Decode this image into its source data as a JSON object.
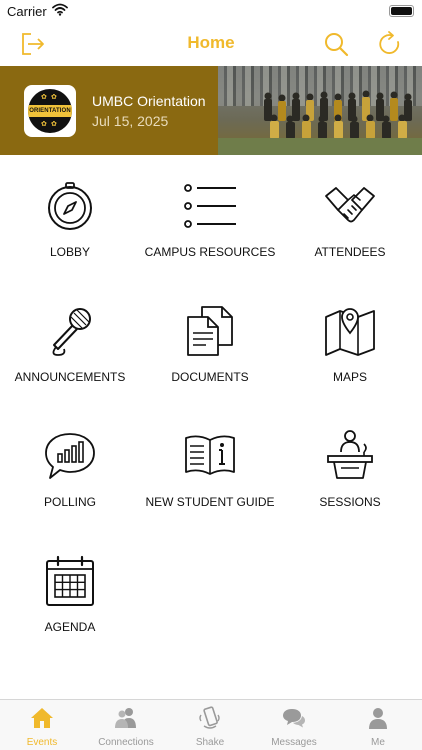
{
  "status_bar": {
    "carrier": "Carrier"
  },
  "nav": {
    "title": "Home"
  },
  "event": {
    "name": "UMBC Orientation",
    "date": "Jul 15, 2025",
    "logo_text": "ORIENTATION"
  },
  "tiles": [
    {
      "label": "LOBBY",
      "icon": "compass-icon"
    },
    {
      "label": "CAMPUS RESOURCES",
      "icon": "list-icon"
    },
    {
      "label": "ATTENDEES",
      "icon": "handshake-icon"
    },
    {
      "label": "ANNOUNCEMENTS",
      "icon": "microphone-icon"
    },
    {
      "label": "DOCUMENTS",
      "icon": "documents-icon"
    },
    {
      "label": "MAPS",
      "icon": "map-icon"
    },
    {
      "label": "POLLING",
      "icon": "poll-icon"
    },
    {
      "label": "NEW STUDENT GUIDE",
      "icon": "guide-book-icon"
    },
    {
      "label": "SESSIONS",
      "icon": "podium-icon"
    },
    {
      "label": "AGENDA",
      "icon": "calendar-icon"
    }
  ],
  "tab_bar": [
    {
      "label": "Events",
      "icon": "home-icon",
      "active": true
    },
    {
      "label": "Connections",
      "icon": "people-icon",
      "active": false
    },
    {
      "label": "Shake",
      "icon": "phone-shake-icon",
      "active": false
    },
    {
      "label": "Messages",
      "icon": "chat-bubbles-icon",
      "active": false
    },
    {
      "label": "Me",
      "icon": "person-icon",
      "active": false
    }
  ],
  "colors": {
    "accent": "#f0b92c",
    "banner": "#8a6911",
    "tab_inactive": "#9a9a9a",
    "icon_stroke": "#111111"
  }
}
